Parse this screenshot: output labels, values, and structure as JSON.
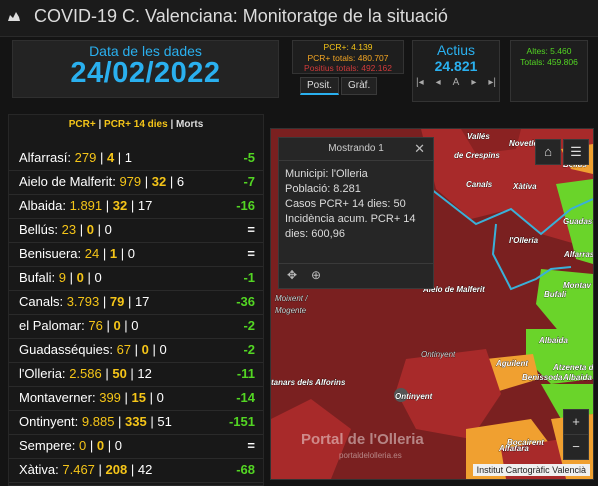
{
  "header": {
    "title": "COVID-19 C. Valenciana: Monitoratge de la situació"
  },
  "date_panel": {
    "label": "Data de les dades",
    "value": "24/02/2022"
  },
  "pcr_panel": {
    "line1": "PCR+: 4.139",
    "line2": "PCR+ totals: 480.707",
    "line3": "Positius totals: 492.162"
  },
  "tabs": [
    {
      "label": "Posit."
    },
    {
      "label": "Gràf."
    }
  ],
  "actius_panel": {
    "label": "Actius",
    "value": "24.821",
    "nav": [
      "|◂",
      "◂",
      "A",
      "▸",
      "▸|"
    ]
  },
  "altes_panel": {
    "line1": "Altes: 5.460",
    "line2": "Totals: 459.806"
  },
  "list": {
    "legend": {
      "pcr": "PCR+",
      "sep": " | ",
      "pcr14": "PCR+ 14 dies",
      "sep2": " | ",
      "morts": "Morts"
    },
    "rows": [
      {
        "name": "Alfarrasí:",
        "pcr": "279",
        "pcr14": "4",
        "morts": "1",
        "delta": "-5"
      },
      {
        "name": "Aielo de Malferit:",
        "pcr": "979",
        "pcr14": "32",
        "morts": "6",
        "delta": "-7"
      },
      {
        "name": "Albaida:",
        "pcr": "1.891",
        "pcr14": "32",
        "morts": "17",
        "delta": "-16"
      },
      {
        "name": "Bellús:",
        "pcr": "23",
        "pcr14": "0",
        "morts": "0",
        "delta": "="
      },
      {
        "name": "Benisuera:",
        "pcr": "24",
        "pcr14": "1",
        "morts": "0",
        "delta": "="
      },
      {
        "name": "Bufali:",
        "pcr": "9",
        "pcr14": "0",
        "morts": "0",
        "delta": "-1"
      },
      {
        "name": "Canals:",
        "pcr": "3.793",
        "pcr14": "79",
        "morts": "17",
        "delta": "-36"
      },
      {
        "name": "el Palomar:",
        "pcr": "76",
        "pcr14": "0",
        "morts": "0",
        "delta": "-2"
      },
      {
        "name": "Guadasséquies:",
        "pcr": "67",
        "pcr14": "0",
        "morts": "0",
        "delta": "-2"
      },
      {
        "name": "l'Olleria:",
        "pcr": "2.586",
        "pcr14": "50",
        "morts": "12",
        "delta": "-11"
      },
      {
        "name": "Montaverner:",
        "pcr": "399",
        "pcr14": "15",
        "morts": "0",
        "delta": "-14"
      },
      {
        "name": "Ontinyent:",
        "pcr": "9.885",
        "pcr14": "335",
        "morts": "51",
        "delta": "-151"
      },
      {
        "name": "Sempere:",
        "pcr": "0",
        "pcr14": "0",
        "morts": "0",
        "delta": "="
      },
      {
        "name": "Xàtiva:",
        "pcr": "7.467",
        "pcr14": "208",
        "morts": "42",
        "delta": "-68"
      }
    ]
  },
  "popup": {
    "title": "Mostrando 1",
    "lines": [
      "Municipi: l'Olleria",
      "Població: 8.281",
      "Casos PCR+ 14 dies: 50",
      "Incidència acum. PCR+ 14",
      "dies: 600,96"
    ]
  },
  "map": {
    "labels": [
      "Vallés",
      "Novetlè",
      "de Crespins",
      "Canals",
      "Xàtiva",
      "Bellús",
      "Guadass",
      "l'Olleria",
      "Alfarrasí",
      "Aielo de Malferit",
      "Montav",
      "Bufali",
      "Moixent /",
      "Mogente",
      "Albaida",
      "Aguilent",
      "Benissoda",
      "Atzeneta d",
      "Albaida",
      "tanars dels Alforins",
      "Ontinyent",
      "Ontinyent",
      "Bocairent",
      "Alfafara"
    ],
    "attribution": "Institut Cartogràfic Valencià",
    "watermark": "Portal de l'Olleria",
    "watermark_sub": "portaldelolleria.es",
    "colors": {
      "dark_red": "#7a2020",
      "red": "#a82a2a",
      "orange": "#f0a030",
      "green": "#6ad42a",
      "border": "#3ab0d8"
    }
  }
}
